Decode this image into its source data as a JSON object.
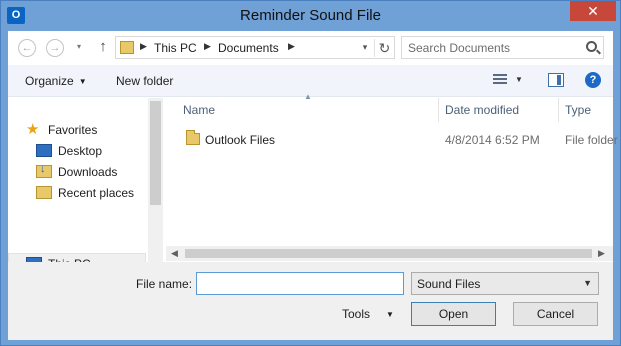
{
  "window": {
    "title": "Reminder Sound File",
    "app_icon_text": "O",
    "close_label": "✕"
  },
  "navbar": {
    "back_icon": "←",
    "forward_icon": "→",
    "up_icon": "↑",
    "breadcrumb": [
      "This PC",
      "Documents"
    ],
    "refresh_icon": "↻",
    "search_placeholder": "Search Documents"
  },
  "toolbar": {
    "organize_label": "Organize",
    "new_folder_label": "New folder",
    "help_icon_text": "?"
  },
  "sidebar": {
    "favorites_label": "Favorites",
    "items": [
      {
        "label": "Desktop"
      },
      {
        "label": "Downloads"
      },
      {
        "label": "Recent places"
      }
    ],
    "this_pc_label": "This PC"
  },
  "filelist": {
    "columns": {
      "name": "Name",
      "date": "Date modified",
      "type": "Type"
    },
    "rows": [
      {
        "name": "Outlook Files",
        "date": "4/8/2014 6:52 PM",
        "type": "File folder"
      }
    ]
  },
  "footer": {
    "file_name_label": "File name:",
    "file_name_value": "",
    "file_type_value": "Sound Files",
    "tools_label": "Tools",
    "open_label": "Open",
    "cancel_label": "Cancel"
  },
  "colors": {
    "titlebar": "#6fa0d6",
    "close": "#c7483b",
    "accent": "#1e68c8"
  }
}
